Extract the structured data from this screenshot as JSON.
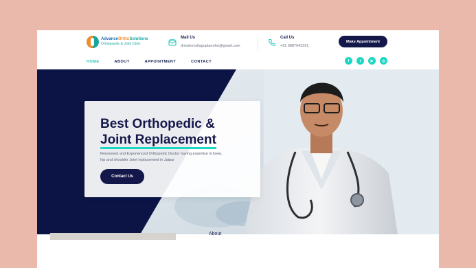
{
  "brand": {
    "name_part1": "Advance",
    "name_part2": "Ortho",
    "name_part3": "Solutions",
    "tagline": "Orthopaedic & Joint Clinic",
    "colors": {
      "navy": "#14174a",
      "teal": "#1ed6c4",
      "orange": "#f28c28"
    }
  },
  "header": {
    "mail": {
      "title": "Mail Us",
      "value": "drmahendraguptaortho@gmail.com",
      "icon": "mail-icon"
    },
    "call": {
      "title": "Call Us",
      "value": "+91 9887643261",
      "icon": "phone-icon"
    },
    "appointment_button": "Make Appointment"
  },
  "nav": {
    "items": [
      {
        "label": "HOME",
        "active": true
      },
      {
        "label": "ABOUT",
        "active": false
      },
      {
        "label": "APPOINTMENT",
        "active": false
      },
      {
        "label": "CONTACT",
        "active": false
      }
    ]
  },
  "socials": [
    {
      "name": "facebook-icon",
      "glyph": "f"
    },
    {
      "name": "twitter-icon",
      "glyph": "t"
    },
    {
      "name": "youtube-icon",
      "glyph": "▶"
    },
    {
      "name": "instagram-icon",
      "glyph": "◎"
    }
  ],
  "hero": {
    "title_line1": "Best Orthopedic &",
    "title_line2": "Joint Replacement",
    "subtitle": "Renowned and Experienced Orthopedic Doctor having expertise in knee, hip and shoulder Joint replacement in Jaipur",
    "cta": "Contact Us"
  },
  "about": {
    "label": "About"
  }
}
